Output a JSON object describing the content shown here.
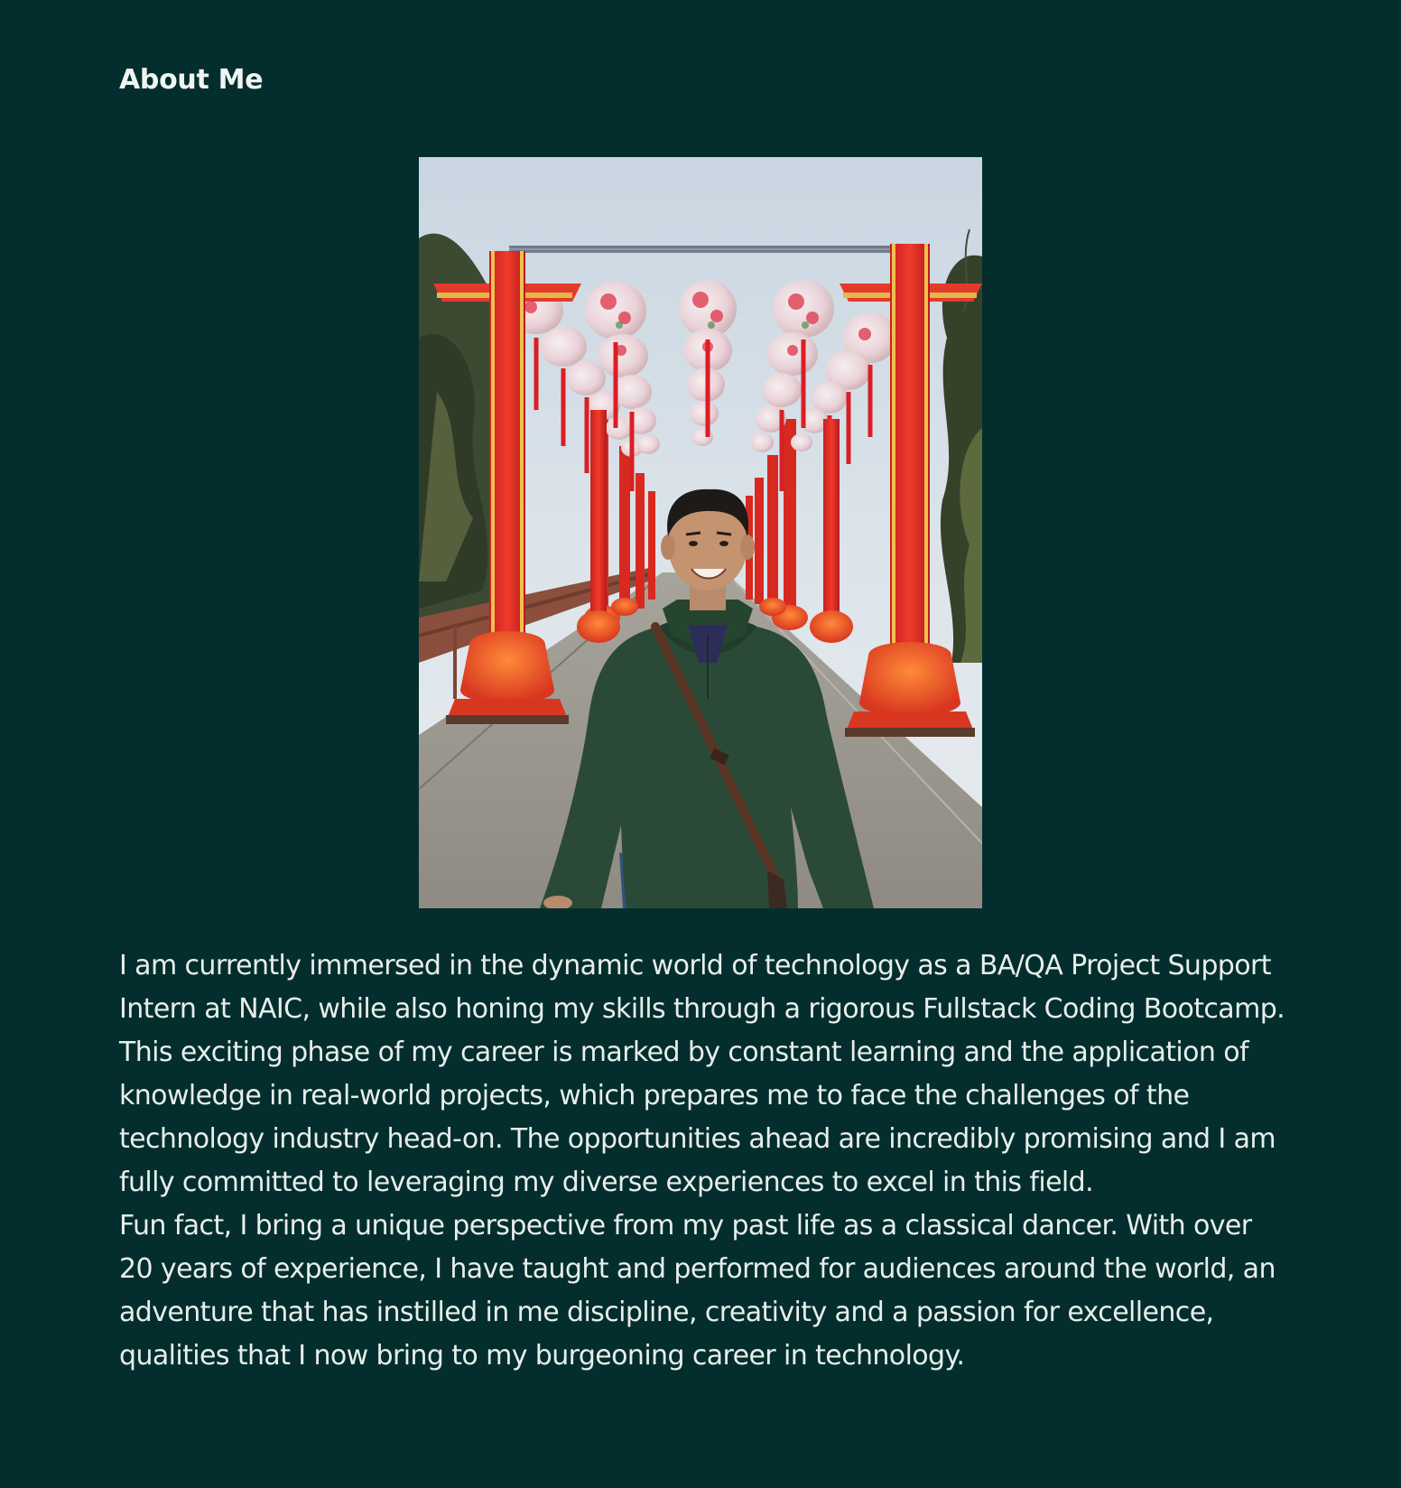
{
  "about": {
    "heading": "About Me",
    "photo_description": "profile-photo",
    "paragraphs": [
      "I am currently immersed in the dynamic world of technology as a BA/QA Project Support Intern at NAIC, while also honing my skills through a rigorous Fullstack Coding Bootcamp. This exciting phase of my career is marked by constant learning and the application of knowledge in real-world projects, which prepares me to face the challenges of the technology industry head-on. The opportunities ahead are incredibly promising and I am fully committed to leveraging my diverse experiences to excel in this field.",
      "Fun fact, I bring a unique perspective from my past life as a classical dancer. With over 20 years of experience, I have taught and performed for audiences around the world, an adventure that has instilled in me discipline, creativity and a passion for excellence, qualities that I now bring to my burgeoning career in technology."
    ]
  },
  "colors": {
    "background": "#032e2d",
    "text": "#e8eeec"
  }
}
